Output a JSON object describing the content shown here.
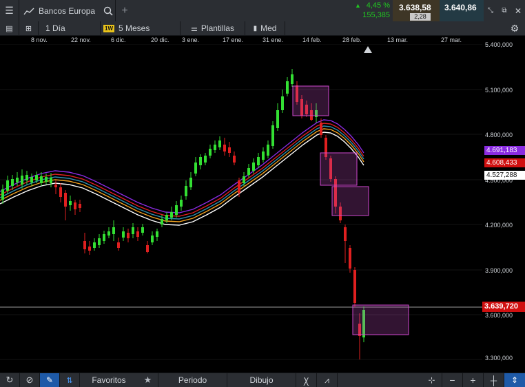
{
  "topbar": {
    "instrument": "Bancos Europa",
    "change_pct": "4,45 %",
    "change_abs": "155,385",
    "bid": "3.638,58",
    "ask": "3.640,86",
    "spread": "2,28"
  },
  "toolbar": {
    "interval": "1 Día",
    "period_badge": "1W",
    "range": "5 Meses",
    "templates": "Plantillas",
    "price_type": "Med"
  },
  "date_axis": [
    "8 nov.",
    "22 nov.",
    "6 dic.",
    "20 dic.",
    "3 ene.",
    "17 ene.",
    "31 ene.",
    "14 feb.",
    "28 feb.",
    "13 mar.",
    "27 mar."
  ],
  "price_axis": [
    "5.400,000",
    "5.100,000",
    "4.800,000",
    "4.500,000",
    "4.200,000",
    "3.900,000",
    "3.600,000",
    "3.300,000"
  ],
  "price_tags": [
    {
      "label": "4.691,183",
      "color": "#8a2be2"
    },
    {
      "label": "4.608,433",
      "color": "#d01010"
    },
    {
      "label": "4.527,288",
      "color": "#ffffff"
    },
    {
      "label": "3.639,720",
      "color": "#d01010"
    }
  ],
  "bottombar": {
    "favorites": "Favoritos",
    "period": "Periodo",
    "drawing": "Dibujo"
  },
  "icons": [
    "menu-icon",
    "chart-line-icon",
    "search-icon",
    "plus-icon",
    "collapse-icon",
    "popout-icon",
    "close-icon",
    "list-icon",
    "layout-icon",
    "templates-icon",
    "candles-icon",
    "settings-icon",
    "refresh-icon",
    "no-icon",
    "pencil-icon",
    "sort-icon",
    "star-icon",
    "crosshair-icon",
    "zoom-out-icon",
    "zoom-in-icon",
    "fullscreen-icon"
  ]
}
